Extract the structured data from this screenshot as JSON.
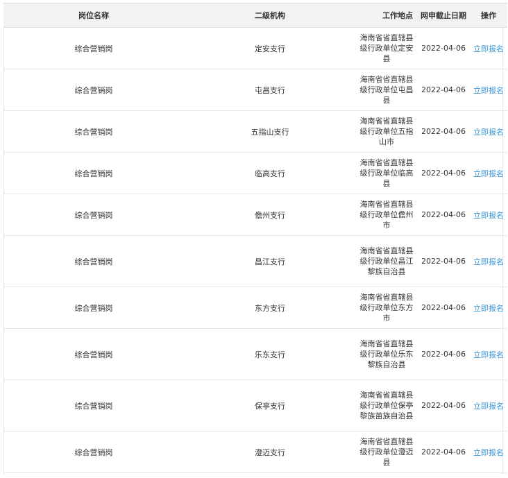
{
  "headers": {
    "position": "岗位名称",
    "branch": "二级机构",
    "location": "工作地点",
    "deadline": "网申截止日期",
    "action": "操作"
  },
  "rows": [
    {
      "position": "综合营销岗",
      "branch": "定安支行",
      "location": "海南省省直辖县级行政单位定安县",
      "deadline": "2022-04-06",
      "action": "立即报名"
    },
    {
      "position": "综合营销岗",
      "branch": "屯昌支行",
      "location": "海南省省直辖县级行政单位屯昌县",
      "deadline": "2022-04-06",
      "action": "立即报名"
    },
    {
      "position": "综合营销岗",
      "branch": "五指山支行",
      "location": "海南省省直辖县级行政单位五指山市",
      "deadline": "2022-04-06",
      "action": "立即报名"
    },
    {
      "position": "综合营销岗",
      "branch": "临高支行",
      "location": "海南省省直辖县级行政单位临高县",
      "deadline": "2022-04-06",
      "action": "立即报名"
    },
    {
      "position": "综合营销岗",
      "branch": "儋州支行",
      "location": "海南省省直辖县级行政单位儋州市",
      "deadline": "2022-04-06",
      "action": "立即报名"
    },
    {
      "position": "综合营销岗",
      "branch": "昌江支行",
      "location": "海南省省直辖县级行政单位昌江黎族自治县",
      "deadline": "2022-04-06",
      "action": "立即报名"
    },
    {
      "position": "综合营销岗",
      "branch": "东方支行",
      "location": "海南省省直辖县级行政单位东方市",
      "deadline": "2022-04-06",
      "action": "立即报名"
    },
    {
      "position": "综合营销岗",
      "branch": "乐东支行",
      "location": "海南省省直辖县级行政单位乐东黎族自治县",
      "deadline": "2022-04-06",
      "action": "立即报名"
    },
    {
      "position": "综合营销岗",
      "branch": "保亭支行",
      "location": "海南省省直辖县级行政单位保亭黎族苗族自治县",
      "deadline": "2022-04-06",
      "action": "立即报名"
    },
    {
      "position": "综合营销岗",
      "branch": "澄迈支行",
      "location": "海南省省直辖县级行政单位澄迈县",
      "deadline": "2022-04-06",
      "action": "立即报名"
    }
  ]
}
